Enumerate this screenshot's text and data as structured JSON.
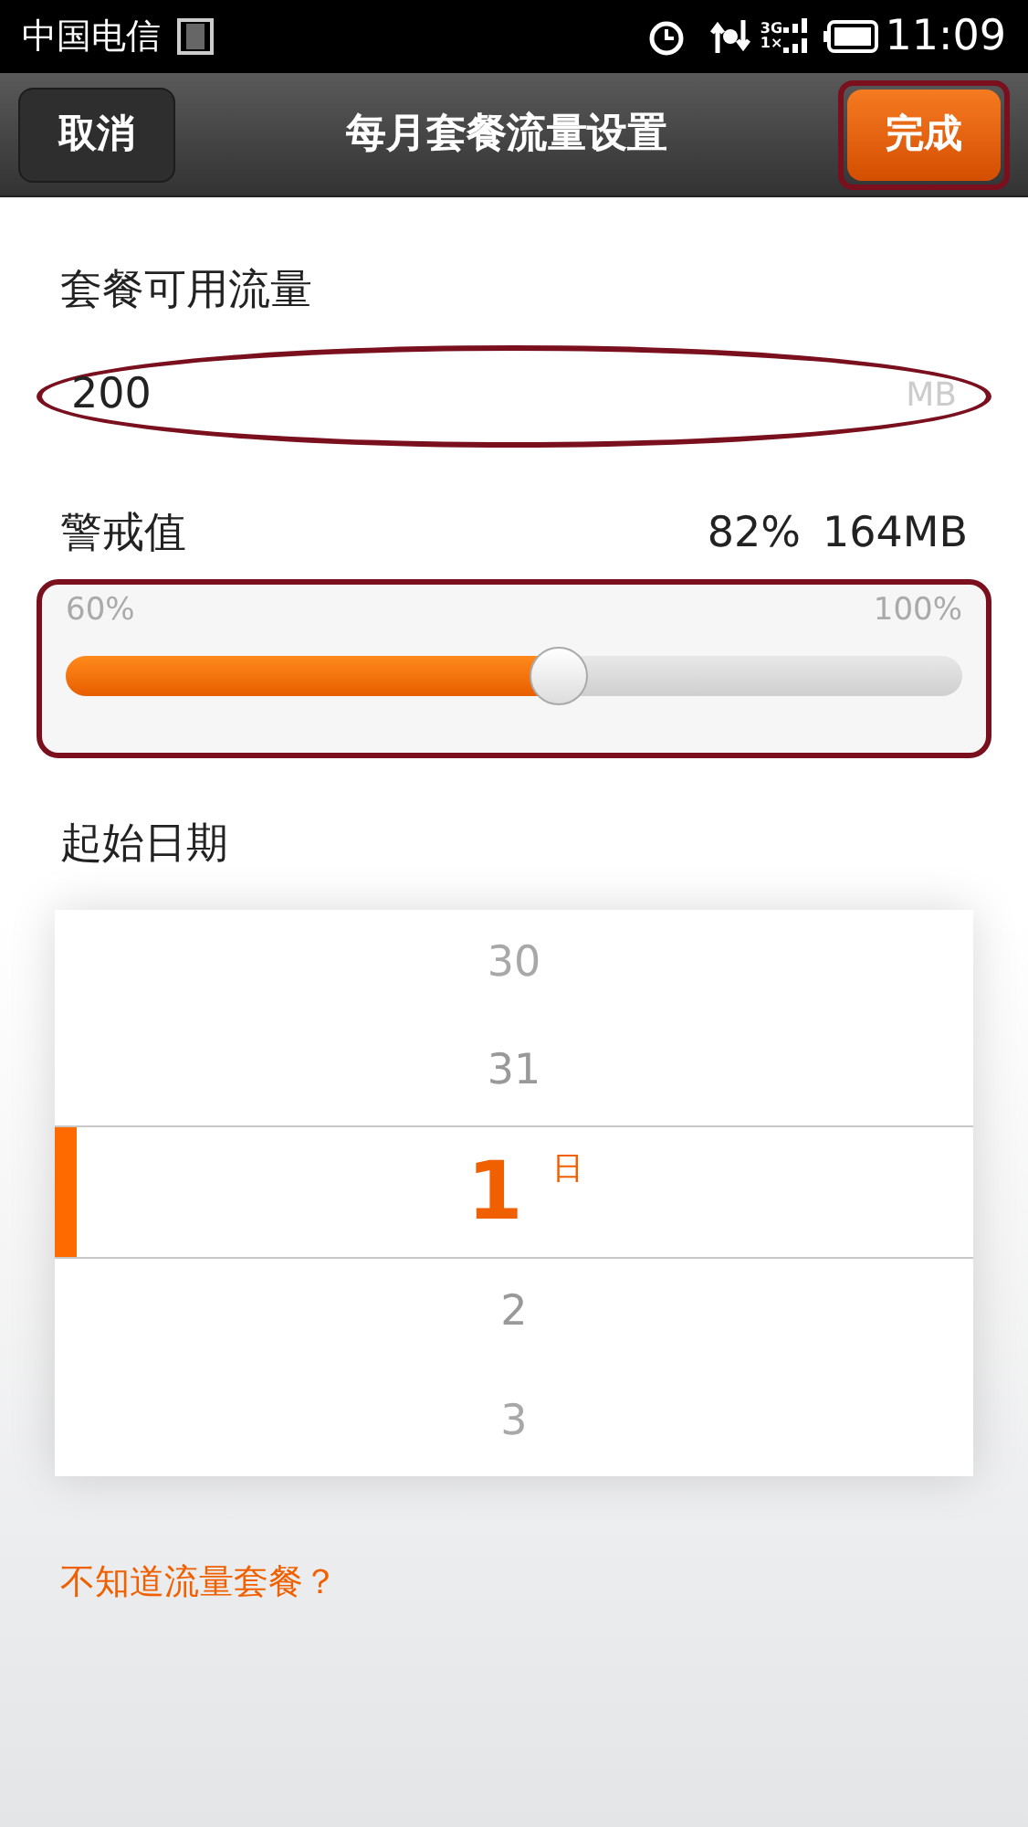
{
  "status_bar": {
    "carrier": "中国电信",
    "network_top": "3G",
    "network_bottom": "1×",
    "time": "11:09"
  },
  "header": {
    "title": "每月套餐流量设置",
    "cancel": "取消",
    "done": {
      "label": "完成",
      "highlighted": true
    }
  },
  "plan_usage": {
    "label": "套餐可用流量",
    "value": "200",
    "unit": "MB",
    "highlighted": true
  },
  "warning": {
    "label": "警戒值",
    "percent": "82%",
    "amount": "164MB",
    "min": "60%",
    "max": "100%",
    "level": 0.55,
    "highlighted": true
  },
  "start_date": {
    "label": "起始日期",
    "unit": "日",
    "days": [
      {
        "label": "30",
        "selected": false
      },
      {
        "label": "31",
        "selected": false
      },
      {
        "label": "1",
        "selected": true
      },
      {
        "label": "2",
        "selected": false
      },
      {
        "label": "3",
        "selected": false
      }
    ]
  },
  "help_link": "不知道流量套餐？"
}
